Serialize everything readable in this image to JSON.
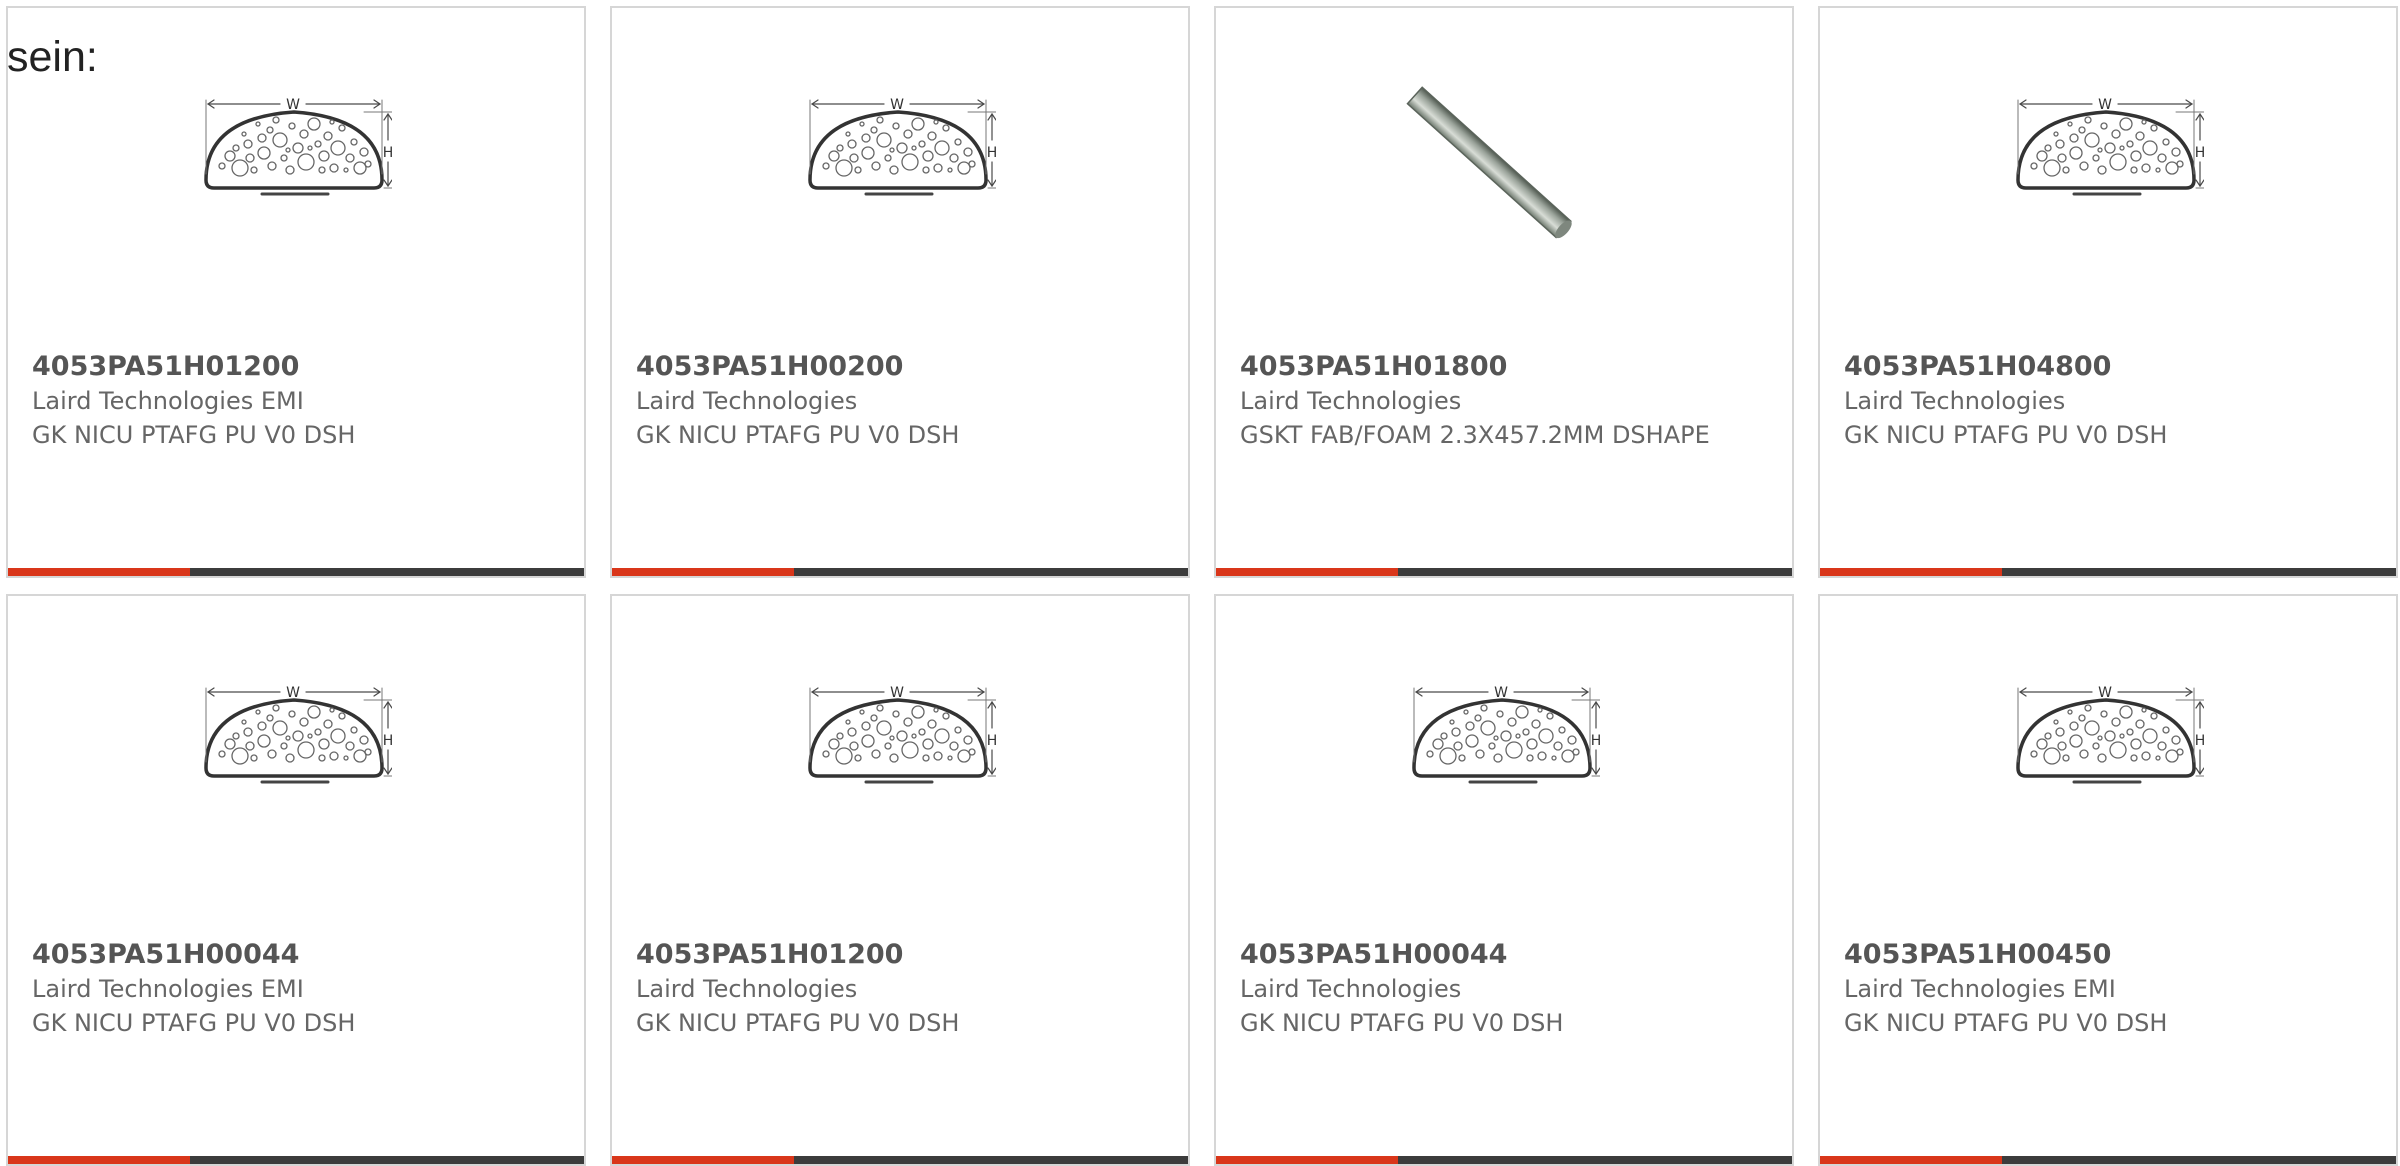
{
  "intro_text": "sein:",
  "colors": {
    "accent": "#d9361a",
    "bar": "#3c3c3c",
    "border": "#d6d6d6",
    "text": "#666666"
  },
  "products": [
    {
      "part_number": "4053PA51H01200",
      "manufacturer": "Laird Technologies EMI",
      "description": "GK NICU PTAFG PU V0 DSH",
      "image": "d-shape-profile-diagram"
    },
    {
      "part_number": "4053PA51H00200",
      "manufacturer": "Laird Technologies",
      "description": "GK NICU PTAFG PU V0 DSH",
      "image": "d-shape-profile-diagram"
    },
    {
      "part_number": "4053PA51H01800",
      "manufacturer": "Laird Technologies",
      "description": "GSKT FAB/FOAM 2.3X457.2MM DSHAPE",
      "image": "gasket-strip-photo"
    },
    {
      "part_number": "4053PA51H04800",
      "manufacturer": "Laird Technologies",
      "description": "GK NICU PTAFG PU V0 DSH",
      "image": "d-shape-profile-diagram"
    },
    {
      "part_number": "4053PA51H00044",
      "manufacturer": "Laird Technologies EMI",
      "description": "GK NICU PTAFG PU V0 DSH",
      "image": "d-shape-profile-diagram"
    },
    {
      "part_number": "4053PA51H01200",
      "manufacturer": "Laird Technologies",
      "description": "GK NICU PTAFG PU V0 DSH",
      "image": "d-shape-profile-diagram"
    },
    {
      "part_number": "4053PA51H00044",
      "manufacturer": "Laird Technologies",
      "description": "GK NICU PTAFG PU V0 DSH",
      "image": "d-shape-profile-diagram"
    },
    {
      "part_number": "4053PA51H00450",
      "manufacturer": "Laird Technologies EMI",
      "description": "GK NICU PTAFG PU V0 DSH",
      "image": "d-shape-profile-diagram"
    }
  ],
  "diagram_labels": {
    "width": "W",
    "height": "H"
  }
}
